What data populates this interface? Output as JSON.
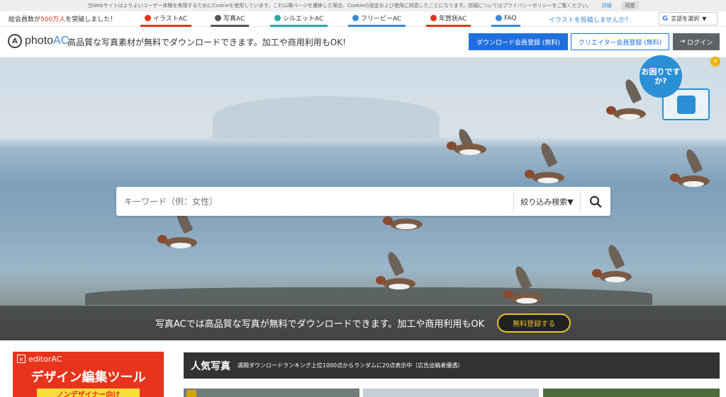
{
  "cookie": {
    "text": "当Webサイトはよりよいユーザー体験を実現するためにCookieを使用しています。これ以降ページを遷移した場合、Cookieの設定および使用に同意したことになります。詳細についてはプライバシーポリシーをご覧ください。",
    "details": "詳細",
    "agree": "同意"
  },
  "topbar": {
    "members_prefix": "総会員数が",
    "members_count": "500万人",
    "members_suffix": "を突破しました！",
    "services": [
      {
        "label": "イラストAC",
        "color": "#e2341d"
      },
      {
        "label": "写真AC",
        "color": "#555555"
      },
      {
        "label": "シルエットAC",
        "color": "#2aa7a0"
      },
      {
        "label": "フリービーAC",
        "color": "#3b8ad8"
      },
      {
        "label": "年賀状AC",
        "color": "#e2341d"
      },
      {
        "label": "FAQ",
        "color": "#3b8ad8"
      }
    ],
    "post_link": "イラストを投稿しませんか？",
    "language": "言語を選択"
  },
  "header": {
    "logo_text": "photo",
    "logo_ac": "AC",
    "tagline": "高品質な写真素材が無料でダウンロードできます。加工や商用利用もOK!",
    "download_register": "ダウンロード会員登録 (無料)",
    "creator_register": "クリエイター会員登録 (無料)",
    "login": "ログイン"
  },
  "search": {
    "placeholder": "キーワード（例：女性）",
    "filter": "絞り込み検索▼"
  },
  "hero_banner": {
    "text": "写真ACでは高品質な写真が無料でダウンロードできます。加工や商用利用もOK",
    "button": "無料登録する"
  },
  "help": {
    "text": "お困りですか?"
  },
  "ad": {
    "brand": "editorAC",
    "headline": "デザイン編集ツール",
    "sub": "ノンデザイナー向け"
  },
  "popular": {
    "heading": "人気写真",
    "desc": "週間ダウンロードランキング上位1000点からランダムに20点表示中（広告出稿者優遇）"
  }
}
